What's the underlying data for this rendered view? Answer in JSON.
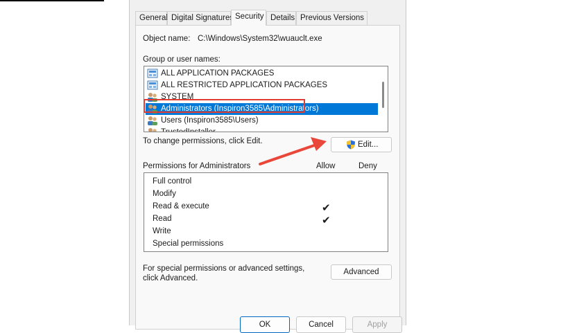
{
  "tabs": [
    {
      "label": "General"
    },
    {
      "label": "Digital Signatures"
    },
    {
      "label": "Security"
    },
    {
      "label": "Details"
    },
    {
      "label": "Previous Versions"
    }
  ],
  "active_tab": "Security",
  "object": {
    "label": "Object name:",
    "value": "C:\\Windows\\System32\\wuauclt.exe"
  },
  "groups": {
    "label": "Group or user names:",
    "items": [
      {
        "name": "ALL APPLICATION PACKAGES",
        "icon": "app-package-icon"
      },
      {
        "name": "ALL RESTRICTED APPLICATION PACKAGES",
        "icon": "app-package-icon"
      },
      {
        "name": "SYSTEM",
        "icon": "users-icon"
      },
      {
        "name": "Administrators (Inspiron3585\\Administrators)",
        "icon": "users-icon",
        "selected": true
      },
      {
        "name": "Users (Inspiron3585\\Users)",
        "icon": "users-icon"
      },
      {
        "name": "TrustedInstaller",
        "icon": "users-icon"
      }
    ]
  },
  "change_hint": "To change permissions, click Edit.",
  "edit_button": "Edit...",
  "permissions": {
    "label": "Permissions for Administrators",
    "allow_header": "Allow",
    "deny_header": "Deny",
    "rows": [
      {
        "name": "Full control",
        "allow": false,
        "deny": false
      },
      {
        "name": "Modify",
        "allow": false,
        "deny": false
      },
      {
        "name": "Read & execute",
        "allow": true,
        "deny": false
      },
      {
        "name": "Read",
        "allow": true,
        "deny": false
      },
      {
        "name": "Write",
        "allow": false,
        "deny": false
      },
      {
        "name": "Special permissions",
        "allow": false,
        "deny": false
      }
    ]
  },
  "advanced_hint": "For special permissions or advanced settings, click Advanced.",
  "advanced_button": "Advanced",
  "footer": {
    "ok": "OK",
    "cancel": "Cancel",
    "apply": "Apply"
  },
  "colors": {
    "selection": "#0078d7",
    "highlight": "#e03c31",
    "arrow": "#e8473a"
  }
}
